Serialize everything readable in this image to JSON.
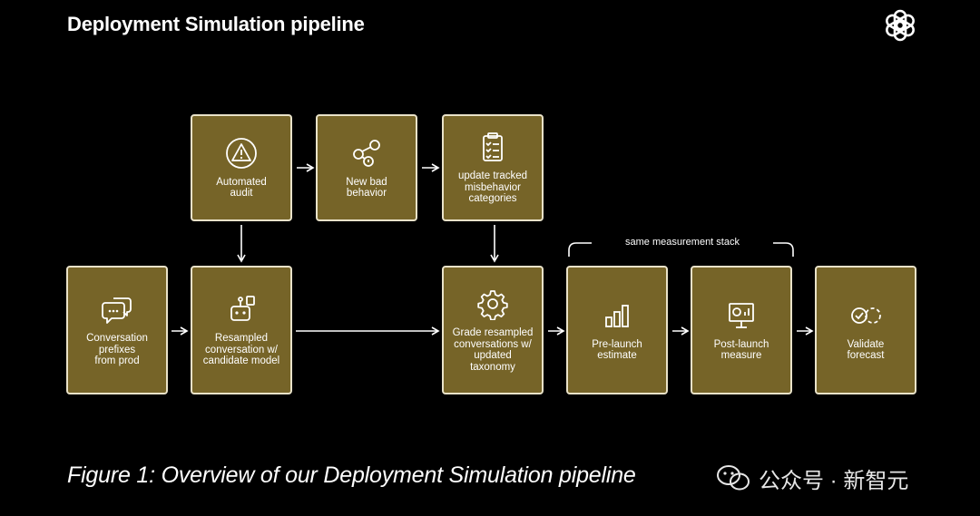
{
  "header": {
    "title": "Deployment Simulation pipeline"
  },
  "logo": {
    "icon": "openai-logo-icon"
  },
  "nodes": [
    {
      "id": "automated-audit",
      "icon": "warning-triangle-icon",
      "label": "Automated\naudit"
    },
    {
      "id": "new-bad-behavior",
      "icon": "nodes-graph-icon",
      "label": "New bad\nbehavior"
    },
    {
      "id": "update-categories",
      "icon": "checklist-icon",
      "label": "update tracked\nmisbehavior\ncategories"
    },
    {
      "id": "conversation-prefixes",
      "icon": "chat-bubbles-icon",
      "label": "Conversation\nprefixes\nfrom prod"
    },
    {
      "id": "resampled-conversation",
      "icon": "robot-icon",
      "label": "Resampled\nconversation w/\ncandidate model"
    },
    {
      "id": "grade-resampled",
      "icon": "gear-icon",
      "label": "Grade resampled\nconversations w/\nupdated\ntaxonomy"
    },
    {
      "id": "pre-launch-estimate",
      "icon": "bar-chart-icon",
      "label": "Pre-launch\nestimate"
    },
    {
      "id": "post-launch-measure",
      "icon": "presentation-board-icon",
      "label": "Post-launch\nmeasure"
    },
    {
      "id": "validate-forecast",
      "icon": "check-compare-icon",
      "label": "Validate\nforecast"
    }
  ],
  "bracket": {
    "label": "same measurement stack"
  },
  "caption": {
    "text": "Figure 1: Overview of our Deployment Simulation pipeline"
  },
  "watermark": {
    "icon": "wechat-icon",
    "text": "公众号 · 新智元"
  },
  "colors": {
    "background": "#000000",
    "box_fill": "#766428",
    "box_border": "#e9e2c9",
    "text": "#ffffff"
  }
}
